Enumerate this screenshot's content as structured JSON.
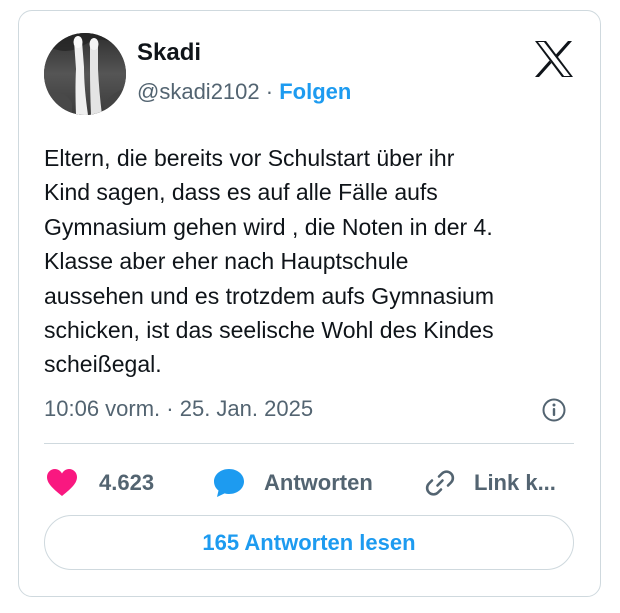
{
  "author": {
    "name": "Skadi",
    "handle": "@skadi2102",
    "separator": "·",
    "follow_label": "Folgen"
  },
  "brand": {
    "logo_icon": "x-logo-icon",
    "text_color": "#0f1419",
    "secondary_color": "#536471",
    "link_color": "#1d9bf0",
    "like_color": "#f91880",
    "border_color": "#cfd9de"
  },
  "tweet": {
    "lines": [
      "Eltern, die bereits vor Schulstart über ihr",
      "Kind sagen, dass es auf alle Fälle aufs",
      "Gymnasium gehen wird , die Noten in der 4.",
      "Klasse aber eher nach Hauptschule",
      "aussehen und es trotzdem aufs Gymnasium",
      "schicken, ist das seelische Wohl des Kindes",
      "scheißegal."
    ],
    "timestamp": "10:06 vorm. · 25. Jan. 2025",
    "info_icon": "info-icon"
  },
  "actions": {
    "likes": {
      "icon": "heart-icon",
      "count": "4.623"
    },
    "reply": {
      "icon": "speech-bubble-icon",
      "label": "Antworten"
    },
    "copy_link": {
      "icon": "link-icon",
      "label": "Link k..."
    }
  },
  "read_replies": {
    "label": "165 Antworten lesen"
  }
}
